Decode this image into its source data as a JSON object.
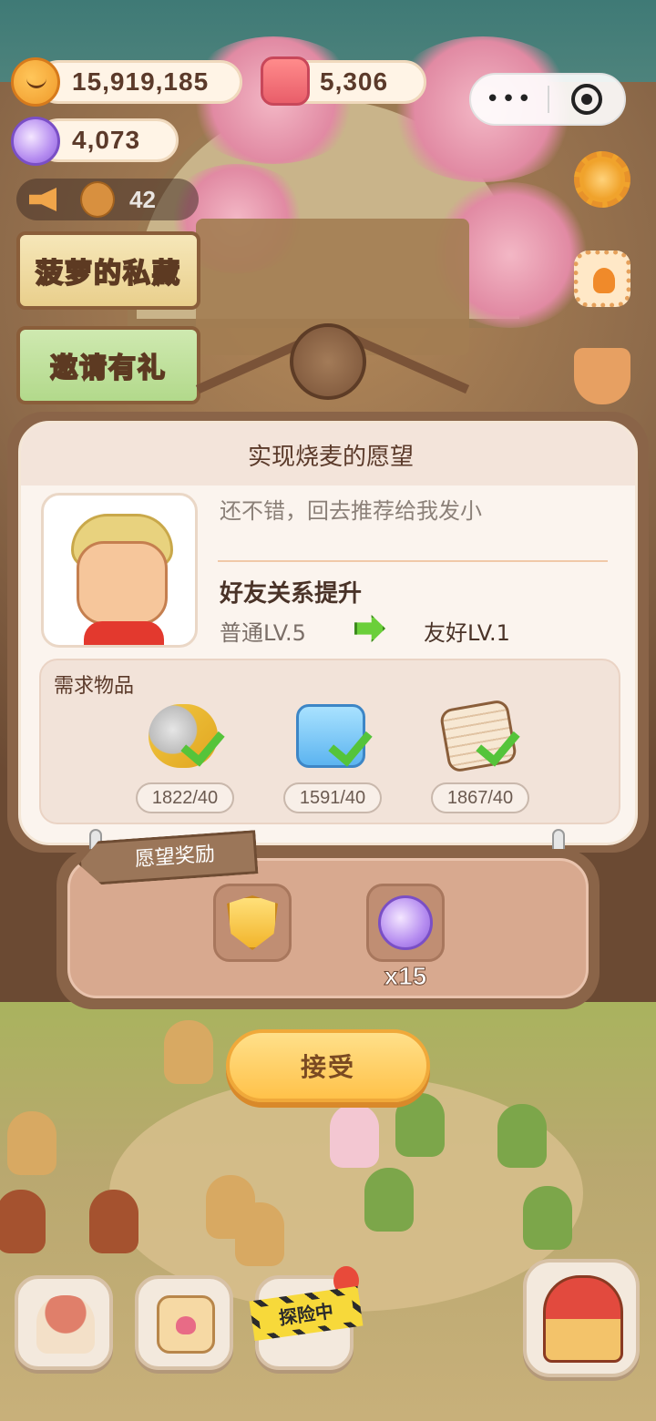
{
  "hud": {
    "cookies": "15,919,185",
    "jelly": "5,306",
    "crystals": "4,073",
    "announcement_count": "42"
  },
  "miniprogram_capsule": {
    "more_icon": "more-dots-icon",
    "close_icon": "target-circle-icon"
  },
  "side_buttons": [
    "gear-icon",
    "stamp-icon",
    "medal-icon"
  ],
  "banners": [
    "菠萝的私藏",
    "邀请有礼"
  ],
  "dialog": {
    "title": "实现烧麦的愿望",
    "quote": "还不错，回去推荐给我发小",
    "relation_title": "好友关系提升",
    "relation_from": "普通LV.5",
    "relation_to": "友好LV.1",
    "requirements_label": "需求物品",
    "requirements": [
      {
        "item": "spoon-fork-icon",
        "count": "1822/40",
        "complete": true
      },
      {
        "item": "detergent-bottle-icon",
        "count": "1591/40",
        "complete": true
      },
      {
        "item": "newspaper-icon",
        "count": "1867/40",
        "complete": true
      }
    ]
  },
  "rewards": {
    "label": "愿望奖励",
    "items": [
      {
        "icon": "shield-badge-icon",
        "qty": ""
      },
      {
        "icon": "candy-crystal-icon",
        "qty": "x15"
      }
    ]
  },
  "accept_label": "接受",
  "dock": {
    "explore_label": "探险中"
  },
  "colors": {
    "dialog_bg": "#fbf4ee",
    "accent_orange": "#ffc24a",
    "check_green": "#55c43a"
  }
}
